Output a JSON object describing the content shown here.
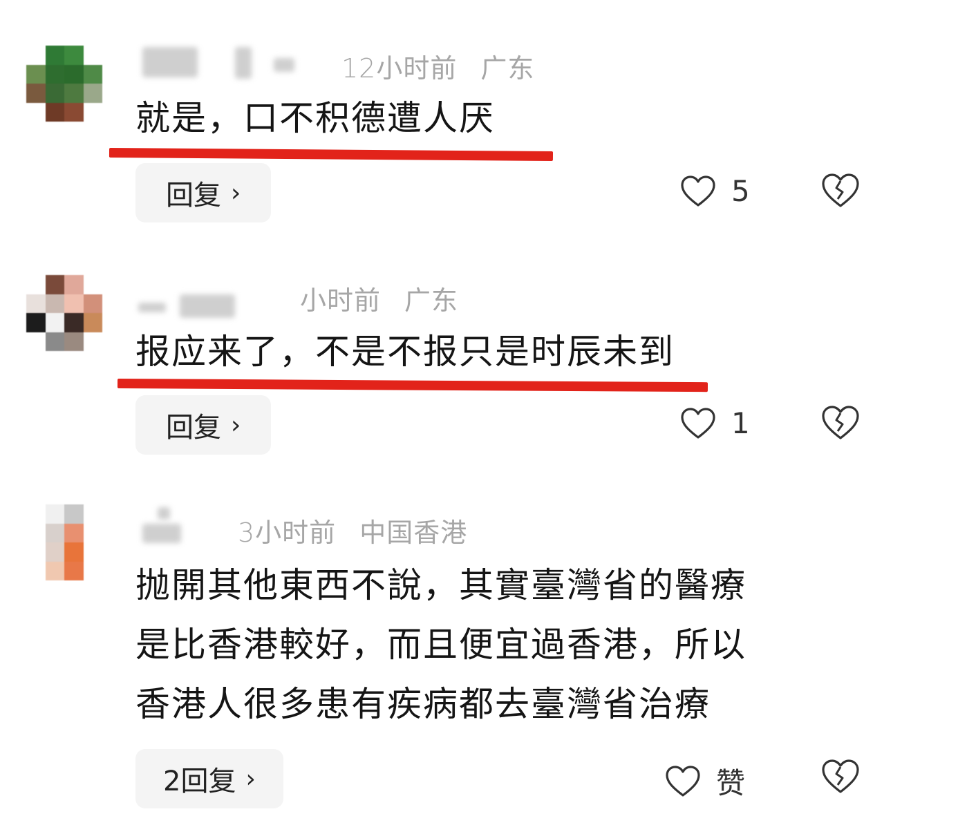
{
  "comments": [
    {
      "time": "12小时前",
      "location": "广东",
      "text": "就是，口不积德遭人厌",
      "reply_label": "回复",
      "like_count": "5"
    },
    {
      "time": "小时前",
      "location": "广东",
      "text": "报应来了，不是不报只是时辰未到",
      "reply_label": "回复",
      "like_count": "1"
    },
    {
      "time": "3小时前",
      "location": "中国香港",
      "text_lines": [
        "抛開其他東西不說，其實臺灣省的醫療",
        "是比香港較好，而且便宜過香港，所以",
        "香港人很多患有疾病都去臺灣省治療"
      ],
      "reply_label": "2回复",
      "like_count": "赞"
    }
  ],
  "icons": {
    "chevron": "chevron-right-icon",
    "like": "heart-outline-icon",
    "dislike": "broken-heart-icon"
  },
  "colors": {
    "underline": "#e2231a",
    "meta_text": "#a6a6a6",
    "body_text": "#151515",
    "reply_bg": "#f4f4f4"
  }
}
